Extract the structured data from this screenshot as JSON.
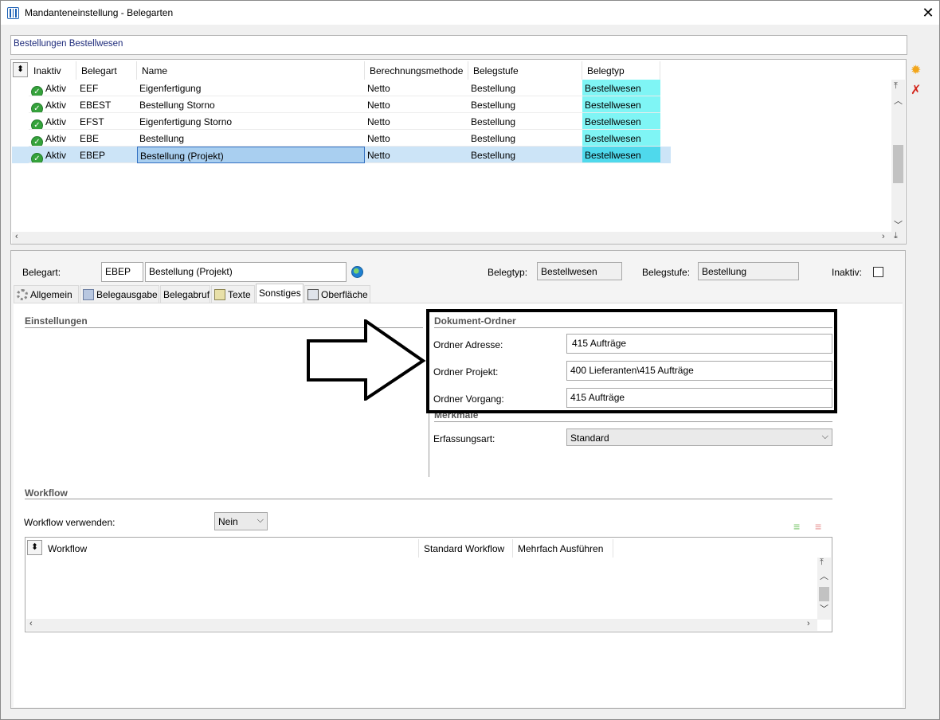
{
  "window": {
    "title": "Mandanteneinstellung - Belegarten",
    "close_glyph": "✕"
  },
  "filter": {
    "value": "Bestellungen Bestellwesen"
  },
  "grid": {
    "sort_glyph": "⬍",
    "columns": [
      "Inaktiv",
      "Belegart",
      "Name",
      "Berechnungsmethode",
      "Belegstufe",
      "Belegtyp"
    ],
    "rows": [
      {
        "inaktiv": "Aktiv",
        "belegart": "EEF",
        "name": "Eigenfertigung",
        "methode": "Netto",
        "stufe": "Bestellung",
        "typ": "Bestellwesen"
      },
      {
        "inaktiv": "Aktiv",
        "belegart": "EBEST",
        "name": "Bestellung Storno",
        "methode": "Netto",
        "stufe": "Bestellung",
        "typ": "Bestellwesen"
      },
      {
        "inaktiv": "Aktiv",
        "belegart": "EFST",
        "name": "Eigenfertigung  Storno",
        "methode": "Netto",
        "stufe": "Bestellung",
        "typ": "Bestellwesen"
      },
      {
        "inaktiv": "Aktiv",
        "belegart": "EBE",
        "name": "Bestellung",
        "methode": "Netto",
        "stufe": "Bestellung",
        "typ": "Bestellwesen"
      },
      {
        "inaktiv": "Aktiv",
        "belegart": "EBEP",
        "name": "Bestellung (Projekt)",
        "methode": "Netto",
        "stufe": "Bestellung",
        "typ": "Bestellwesen"
      }
    ]
  },
  "side_tools": {
    "new_icon": "sun-star-icon",
    "delete_icon": "red-cross-icon"
  },
  "detail": {
    "belegart_label": "Belegart:",
    "belegart_code": "EBEP",
    "belegart_name": "Bestellung (Projekt)",
    "belegtyp_label": "Belegtyp:",
    "belegtyp_value": "Bestellwesen",
    "belegstufe_label": "Belegstufe:",
    "belegstufe_value": "Bestellung",
    "inaktiv_label": "Inaktiv:"
  },
  "tabs": [
    "Allgemein",
    "Belegausgabe",
    "Belegabruf",
    "Texte",
    "Sonstiges",
    "Oberfläche"
  ],
  "einstellungen": {
    "title": "Einstellungen"
  },
  "dokument_ordner": {
    "title": "Dokument-Ordner",
    "adresse_label": "Ordner Adresse:",
    "adresse_value": "415 Aufträge",
    "projekt_label": "Ordner Projekt:",
    "projekt_value": "400 Lieferanten\\415 Aufträge",
    "vorgang_label": "Ordner Vorgang:",
    "vorgang_value": "415 Aufträge"
  },
  "merkmale": {
    "title": "Merkmale",
    "erfassungsart_label": "Erfassungsart:",
    "erfassungsart_value": "Standard"
  },
  "workflow": {
    "title": "Workflow",
    "verwenden_label": "Workflow verwenden:",
    "verwenden_value": "Nein",
    "columns": [
      "Workflow",
      "Standard Workflow",
      "Mehrfach Ausführen"
    ]
  },
  "colors": {
    "belegtyp_cell": "#7ff5f5",
    "selected_row": "#cce4f7",
    "highlight_border": "#000000",
    "filter_text": "#1d2a7a"
  }
}
